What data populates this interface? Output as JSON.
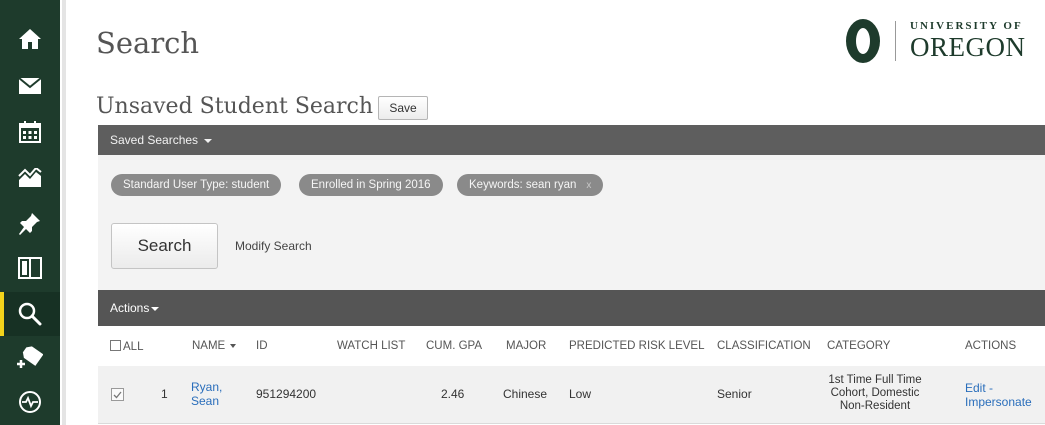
{
  "sidebar": {
    "items": [
      {
        "name": "home",
        "icon": "home-icon"
      },
      {
        "name": "mail",
        "icon": "mail-icon"
      },
      {
        "name": "calendar",
        "icon": "calendar-icon"
      },
      {
        "name": "chart",
        "icon": "area-chart-icon"
      },
      {
        "name": "pin",
        "icon": "pushpin-icon"
      },
      {
        "name": "book",
        "icon": "book-icon"
      },
      {
        "name": "search",
        "icon": "search-icon",
        "active": true
      },
      {
        "name": "add-note",
        "icon": "add-tag-icon"
      },
      {
        "name": "pulse",
        "icon": "pulse-icon"
      }
    ],
    "background": "#1e3b2c",
    "active_indicator": "#f2d31b"
  },
  "header": {
    "title": "Search",
    "logo": {
      "line1": "UNIVERSITY OF",
      "line2": "OREGON",
      "color": "#1e3b2c"
    }
  },
  "search": {
    "title": "Unsaved Student Search",
    "save_label": "Save",
    "saved_searches_label": "Saved Searches",
    "chips": [
      {
        "label": "Standard User Type: student",
        "removable": false
      },
      {
        "label": "Enrolled in Spring 2016",
        "removable": false
      },
      {
        "label": "Keywords: sean ryan",
        "removable": true,
        "remove_label": "x"
      }
    ],
    "search_button": "Search",
    "modify_link": "Modify Search"
  },
  "table": {
    "actions_label": "Actions",
    "columns": {
      "all": "ALL",
      "name": "NAME",
      "id": "ID",
      "watch_list": "WATCH LIST",
      "gpa": "CUM. GPA",
      "major": "MAJOR",
      "risk": "PREDICTED RISK LEVEL",
      "classification": "CLASSIFICATION",
      "category": "CATEGORY",
      "actions": "ACTIONS"
    },
    "rows": [
      {
        "checked": true,
        "index": "1",
        "name_line1": "Ryan,",
        "name_line2": "Sean",
        "id": "951294200",
        "watch_list": "",
        "gpa": "2.46",
        "major": "Chinese",
        "risk": "Low",
        "classification": "Senior",
        "category_line1": "1st Time Full Time",
        "category_line2": "Cohort, Domestic",
        "category_line3": "Non-Resident",
        "action_edit": "Edit -",
        "action_impersonate": "Impersonate"
      }
    ],
    "link_color": "#2a6ebb"
  }
}
